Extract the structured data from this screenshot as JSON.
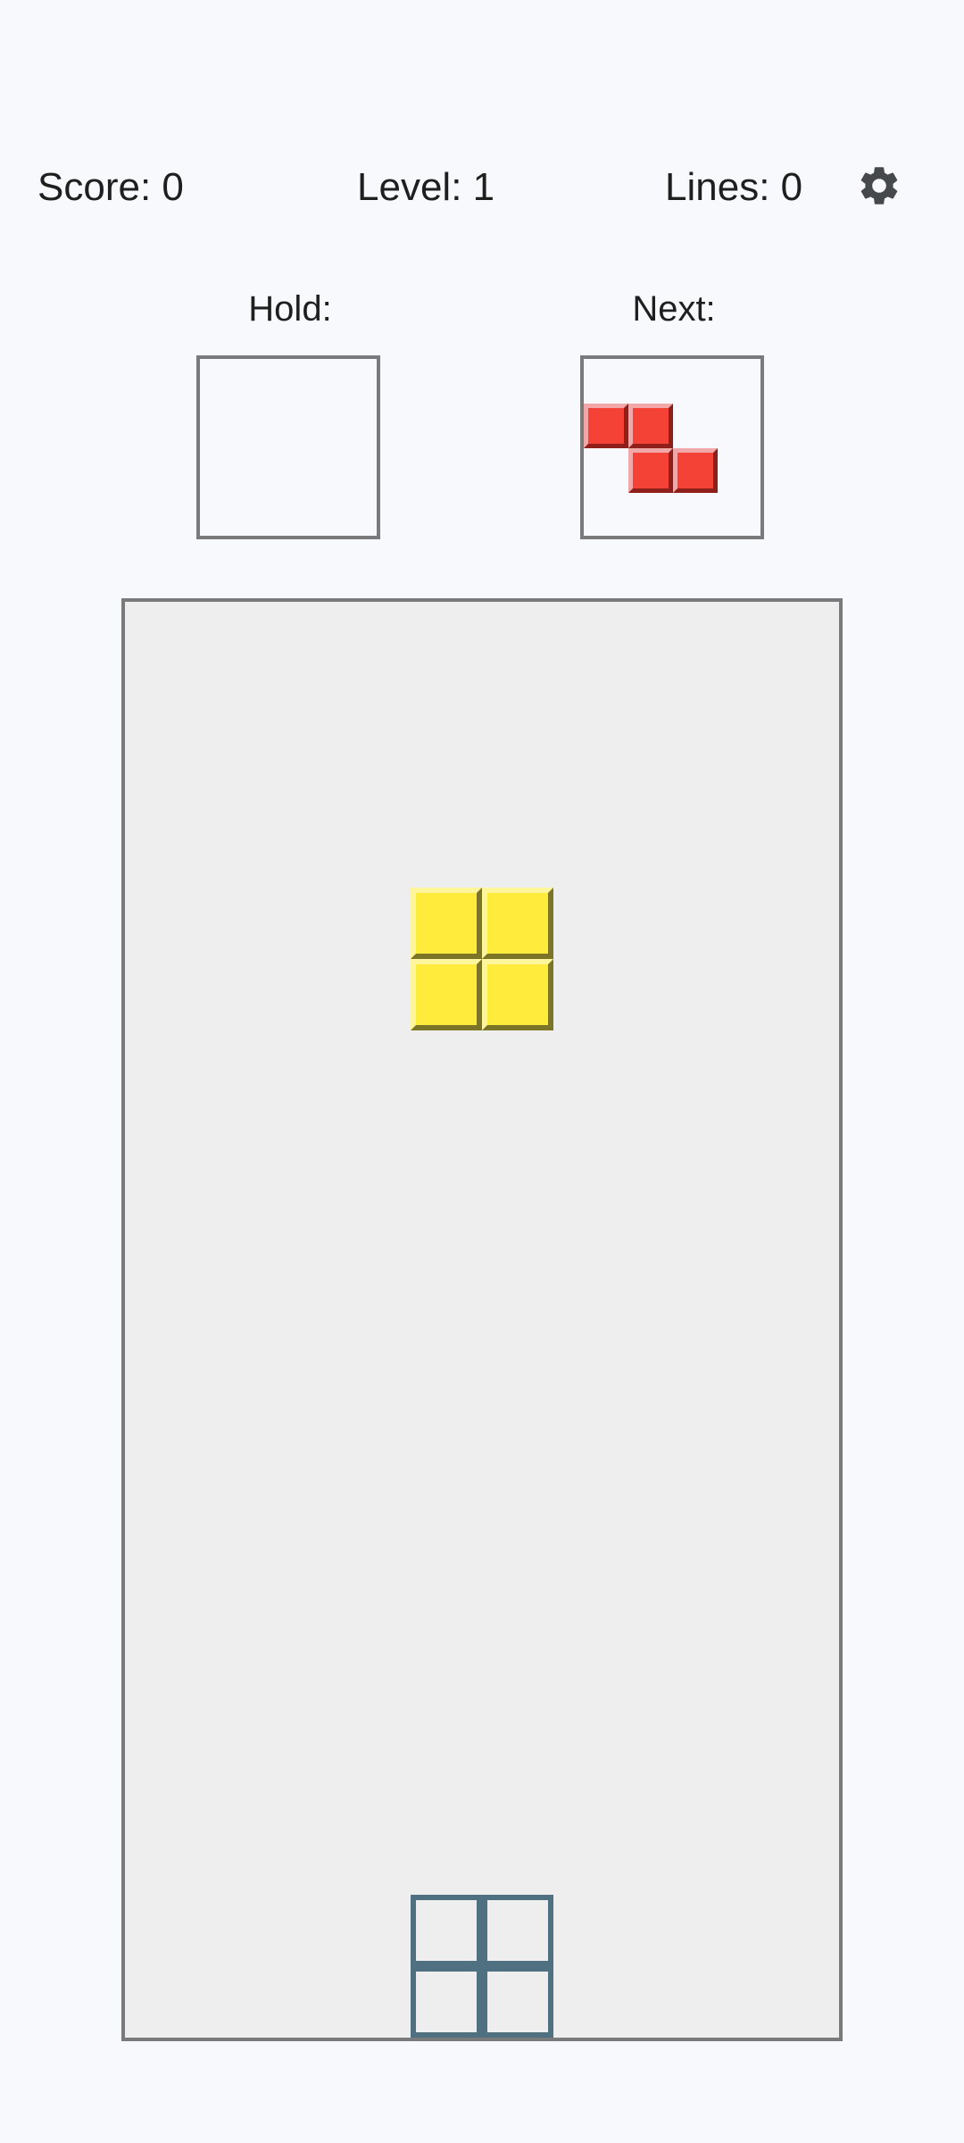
{
  "stats": {
    "score": "Score: 0",
    "level": "Level: 1",
    "lines": "Lines: 0"
  },
  "settings": {
    "icon": "gear-icon"
  },
  "hold": {
    "label": "Hold:",
    "piece": null
  },
  "next": {
    "label": "Next:",
    "piece": "Z",
    "color": "#f44336"
  },
  "board": {
    "columns": 10,
    "rows": 20,
    "active_piece": {
      "type": "O",
      "color": "#ffeb3b"
    },
    "ghost_piece": {
      "type": "O",
      "color": "#4e7080"
    }
  },
  "colors": {
    "background": "#f7f9fc",
    "board": "#eeeeee",
    "border": "#7a7a7d"
  }
}
